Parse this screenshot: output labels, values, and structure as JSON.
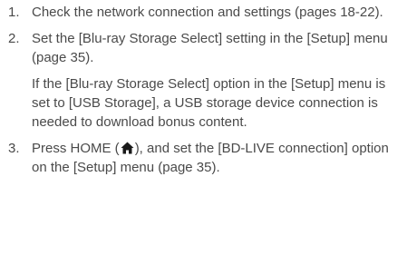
{
  "steps": [
    {
      "number": "1.",
      "text": "Check the network connection and settings (pages 18-22)."
    },
    {
      "number": "2.",
      "text": "Set the [Blu-ray Storage Select] setting in the [Setup] menu (page 35).",
      "note": "If the [Blu-ray Storage Select] option in the [Setup] menu is set to [USB Storage], a USB storage device connection is needed to download bonus content."
    },
    {
      "number": "3.",
      "text_before_icon": "Press HOME (",
      "icon": "home-icon",
      "text_after_icon": "), and set the [BD-LIVE connection] option on the [Setup] menu (page 35)."
    }
  ]
}
